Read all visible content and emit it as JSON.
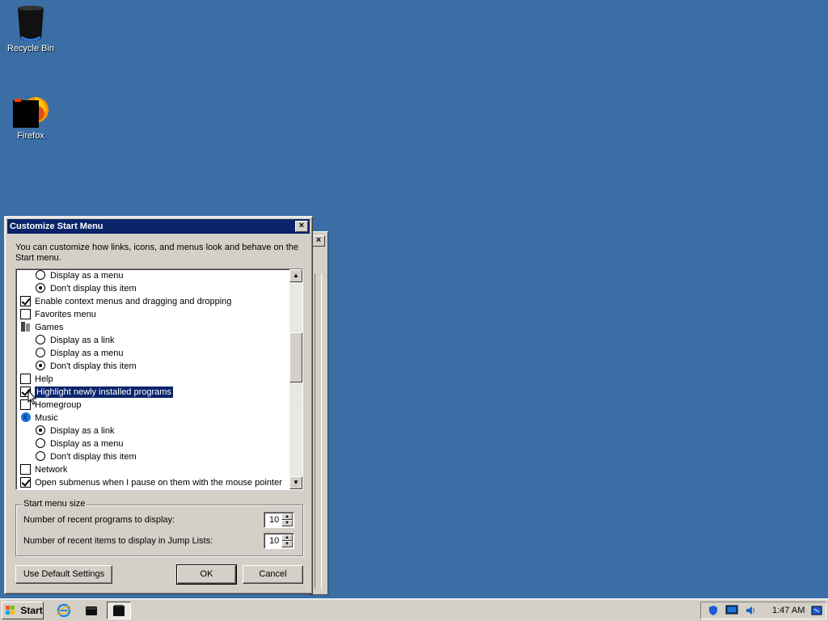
{
  "desktop": {
    "icons": [
      {
        "label": "Recycle Bin",
        "icon": "recycle-bin-icon"
      },
      {
        "label": "Firefox",
        "icon": "firefox-icon"
      }
    ]
  },
  "dialog": {
    "title": "Customize Start Menu",
    "close_label": "×",
    "intro": "You can customize how links, icons, and menus look and behave on the Start menu.",
    "tree_items": [
      {
        "type": "radio",
        "label": "Display as a menu",
        "selected": false
      },
      {
        "type": "radio",
        "label": "Don't display this item",
        "selected": true
      },
      {
        "type": "checkbox",
        "label": "Enable context menus and dragging and dropping",
        "checked": true
      },
      {
        "type": "checkbox",
        "label": "Favorites menu",
        "checked": false
      },
      {
        "type": "folder",
        "label": "Games",
        "icon": "games-icon"
      },
      {
        "type": "radio",
        "label": "Display as a link",
        "selected": false
      },
      {
        "type": "radio",
        "label": "Display as a menu",
        "selected": false
      },
      {
        "type": "radio",
        "label": "Don't display this item",
        "selected": true
      },
      {
        "type": "checkbox",
        "label": "Help",
        "checked": false
      },
      {
        "type": "checkbox",
        "label": "Highlight newly installed programs",
        "checked": true,
        "highlighted": true
      },
      {
        "type": "checkbox",
        "label": "Homegroup",
        "checked": false
      },
      {
        "type": "folder",
        "label": "Music",
        "icon": "music-icon"
      },
      {
        "type": "radio",
        "label": "Display as a link",
        "selected": true
      },
      {
        "type": "radio",
        "label": "Display as a menu",
        "selected": false
      },
      {
        "type": "radio",
        "label": "Don't display this item",
        "selected": false
      },
      {
        "type": "checkbox",
        "label": "Network",
        "checked": false
      },
      {
        "type": "checkbox",
        "label": "Open submenus when I pause on them with the mouse pointer",
        "checked": true
      }
    ],
    "start_menu_size": {
      "legend": "Start menu size",
      "recent_programs_label": "Number of recent programs to display:",
      "recent_programs_value": "10",
      "recent_items_label": "Number of recent items to display in Jump Lists:",
      "recent_items_value": "10"
    },
    "buttons": {
      "defaults": "Use Default Settings",
      "ok": "OK",
      "cancel": "Cancel"
    }
  },
  "taskbar": {
    "start_label": "Start",
    "clock": "1:47 AM"
  },
  "colors": {
    "desktop": "#3a6ea5",
    "titlebar": "#0a246a",
    "face": "#d4d0c8"
  }
}
